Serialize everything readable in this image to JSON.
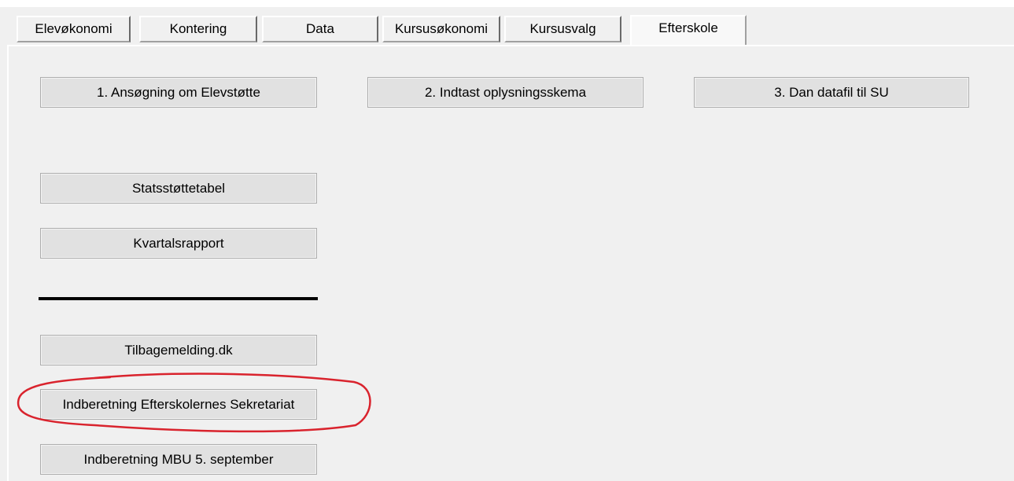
{
  "tabs": [
    {
      "label": "Elevøkonomi",
      "active": false
    },
    {
      "label": "Kontering",
      "active": false
    },
    {
      "label": "Data",
      "active": false
    },
    {
      "label": "Kursusøkonomi",
      "active": false
    },
    {
      "label": "Kursusvalg",
      "active": false
    },
    {
      "label": "Efterskole",
      "active": true
    }
  ],
  "top_buttons": {
    "ansogning": "1. Ansøgning om Elevstøtte",
    "indtast": "2. Indtast oplysningsskema",
    "datafil": "3. Dan datafil til SU"
  },
  "buttons": {
    "statsstottetabel": "Statsstøttetabel",
    "kvartalsrapport": "Kvartalsrapport",
    "tilbagemelding": "Tilbagemelding.dk",
    "indberetning_sekretariat": "Indberetning Efterskolernes Sekretariat",
    "indberetning_mbu": "Indberetning MBU 5. september"
  },
  "colors": {
    "background": "#f0f0f0",
    "button_face": "#e1e1e1",
    "annotation_ring": "#d9232d"
  }
}
